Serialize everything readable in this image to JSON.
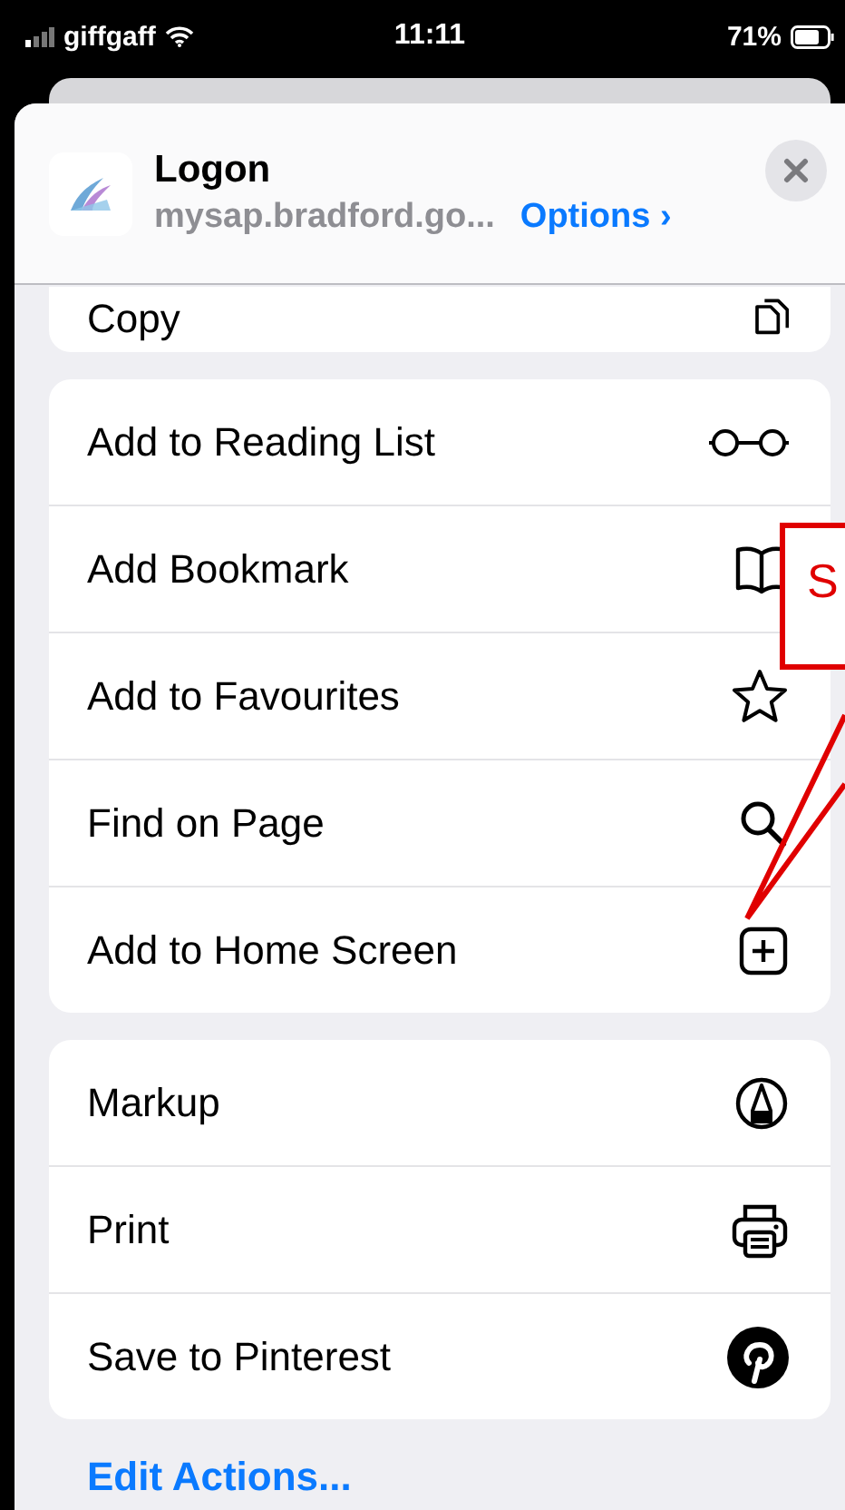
{
  "status_bar": {
    "carrier": "giffgaff",
    "time": "11:11",
    "battery": "71%"
  },
  "header": {
    "title": "Logon",
    "url": "mysap.bradford.go...",
    "options": "Options ›"
  },
  "groups": [
    {
      "rows": [
        {
          "label": "Copy",
          "kind": "copy"
        }
      ]
    },
    {
      "rows": [
        {
          "label": "Add to Reading List",
          "kind": "glasses"
        },
        {
          "label": "Add Bookmark",
          "kind": "book"
        },
        {
          "label": "Add to Favourites",
          "kind": "star"
        },
        {
          "label": "Find on Page",
          "kind": "search"
        },
        {
          "label": "Add to Home Screen",
          "kind": "plus"
        }
      ]
    },
    {
      "rows": [
        {
          "label": "Markup",
          "kind": "markup"
        },
        {
          "label": "Print",
          "kind": "print"
        },
        {
          "label": "Save to Pinterest",
          "kind": "pinterest"
        }
      ]
    }
  ],
  "edit_actions": "Edit Actions...",
  "callout": {
    "text": "S"
  }
}
